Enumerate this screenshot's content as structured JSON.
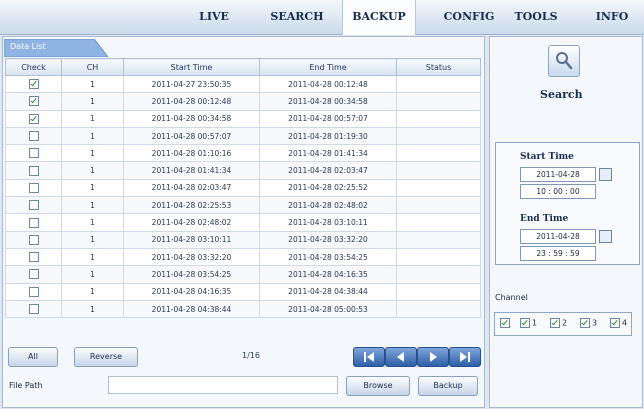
{
  "nav": {
    "tabs": [
      {
        "label": "LIVE"
      },
      {
        "label": "SEARCH"
      },
      {
        "label": "BACKUP"
      },
      {
        "label": "CONFIG"
      },
      {
        "label": "TOOLS"
      },
      {
        "label": "INFO"
      }
    ],
    "active": "BACKUP"
  },
  "data_list": {
    "tab_label": "Data List",
    "columns": [
      "Check",
      "CH",
      "Start Time",
      "End Time",
      "Status"
    ],
    "rows": [
      {
        "checked": true,
        "ch": "1",
        "start": "2011-04-27 23:50:35",
        "end": "2011-04-28 00:12:48",
        "status": ""
      },
      {
        "checked": true,
        "ch": "1",
        "start": "2011-04-28 00:12:48",
        "end": "2011-04-28 00:34:58",
        "status": ""
      },
      {
        "checked": true,
        "ch": "1",
        "start": "2011-04-28 00:34:58",
        "end": "2011-04-28 00:57:07",
        "status": ""
      },
      {
        "checked": false,
        "ch": "1",
        "start": "2011-04-28 00:57:07",
        "end": "2011-04-28 01:19:30",
        "status": ""
      },
      {
        "checked": false,
        "ch": "1",
        "start": "2011-04-28 01:10:16",
        "end": "2011-04-28 01:41:34",
        "status": ""
      },
      {
        "checked": false,
        "ch": "1",
        "start": "2011-04-28 01:41:34",
        "end": "2011-04-28 02:03:47",
        "status": ""
      },
      {
        "checked": false,
        "ch": "1",
        "start": "2011-04-28 02:03:47",
        "end": "2011-04-28 02:25:52",
        "status": ""
      },
      {
        "checked": false,
        "ch": "1",
        "start": "2011-04-28 02:25:53",
        "end": "2011-04-28 02:48:02",
        "status": ""
      },
      {
        "checked": false,
        "ch": "1",
        "start": "2011-04-28 02:48:02",
        "end": "2011-04-28 03:10:11",
        "status": ""
      },
      {
        "checked": false,
        "ch": "1",
        "start": "2011-04-28 03:10:11",
        "end": "2011-04-28 03:32:20",
        "status": ""
      },
      {
        "checked": false,
        "ch": "1",
        "start": "2011-04-28 03:32:20",
        "end": "2011-04-28 03:54:25",
        "status": ""
      },
      {
        "checked": false,
        "ch": "1",
        "start": "2011-04-28 03:54:25",
        "end": "2011-04-28 04:16:35",
        "status": ""
      },
      {
        "checked": false,
        "ch": "1",
        "start": "2011-04-28 04:16:35",
        "end": "2011-04-28 04:38:44",
        "status": ""
      },
      {
        "checked": false,
        "ch": "1",
        "start": "2011-04-28 04:38:44",
        "end": "2011-04-28 05:00:53",
        "status": ""
      }
    ]
  },
  "controls": {
    "all_label": "All",
    "reverse_label": "Reverse",
    "page_indicator": "1/16",
    "file_path_label": "File Path",
    "file_path_value": "",
    "browse_label": "Browse",
    "backup_label": "Backup"
  },
  "search": {
    "label": "Search",
    "icon": "magnifier-icon",
    "start_time_label": "Start Time",
    "start_date": "2011-04-28",
    "start_time": "10 : 00 : 00",
    "end_time_label": "End Time",
    "end_date": "2011-04-28",
    "end_time": "23 : 59 : 59"
  },
  "channel": {
    "label": "Channel",
    "items": [
      {
        "label": "",
        "checked": true
      },
      {
        "label": "1",
        "checked": true
      },
      {
        "label": "2",
        "checked": true
      },
      {
        "label": "3",
        "checked": true
      },
      {
        "label": "4",
        "checked": true
      }
    ]
  },
  "colors": {
    "accent": "#2f5fa8",
    "tab_blue": "#8fb3e3",
    "check_green": "#2a8a3a"
  }
}
